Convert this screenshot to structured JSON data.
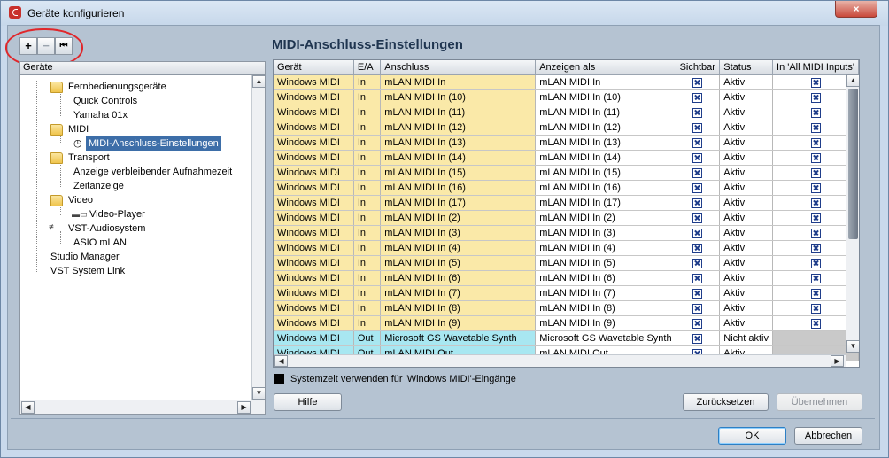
{
  "window": {
    "title": "Geräte konfigurieren",
    "close_glyph": "×"
  },
  "toolbar": {
    "add": "+",
    "remove": "−",
    "reset": "⏮"
  },
  "tree": {
    "header": "Geräte",
    "items": [
      {
        "label": "Fernbedienungsgeräte"
      },
      {
        "label": "Quick Controls"
      },
      {
        "label": "Yamaha 01x"
      },
      {
        "label": "MIDI"
      },
      {
        "label": "MIDI-Anschluss-Einstellungen"
      },
      {
        "label": "Transport"
      },
      {
        "label": "Anzeige verbleibender Aufnahmezeit"
      },
      {
        "label": "Zeitanzeige"
      },
      {
        "label": "Video"
      },
      {
        "label": "Video-Player"
      },
      {
        "label": "VST-Audiosystem"
      },
      {
        "label": "ASIO mLAN"
      },
      {
        "label": "Studio Manager"
      },
      {
        "label": "VST System Link"
      }
    ]
  },
  "panel": {
    "heading": "MIDI-Anschluss-Einstellungen"
  },
  "table": {
    "columns": [
      "Gerät",
      "E/A",
      "Anschluss",
      "Anzeigen als",
      "Sichtbar",
      "Status",
      "In 'All MIDI Inputs'"
    ],
    "rows": [
      {
        "device": "Windows MIDI",
        "io": "In",
        "port": "mLAN MIDI In",
        "show_as": "mLAN MIDI In",
        "visible": true,
        "status": "Aktiv",
        "all_inputs": true
      },
      {
        "device": "Windows MIDI",
        "io": "In",
        "port": "mLAN MIDI In (10)",
        "show_as": "mLAN MIDI In (10)",
        "visible": true,
        "status": "Aktiv",
        "all_inputs": true
      },
      {
        "device": "Windows MIDI",
        "io": "In",
        "port": "mLAN MIDI In (11)",
        "show_as": "mLAN MIDI In (11)",
        "visible": true,
        "status": "Aktiv",
        "all_inputs": true
      },
      {
        "device": "Windows MIDI",
        "io": "In",
        "port": "mLAN MIDI In (12)",
        "show_as": "mLAN MIDI In (12)",
        "visible": true,
        "status": "Aktiv",
        "all_inputs": true
      },
      {
        "device": "Windows MIDI",
        "io": "In",
        "port": "mLAN MIDI In (13)",
        "show_as": "mLAN MIDI In (13)",
        "visible": true,
        "status": "Aktiv",
        "all_inputs": true
      },
      {
        "device": "Windows MIDI",
        "io": "In",
        "port": "mLAN MIDI In (14)",
        "show_as": "mLAN MIDI In (14)",
        "visible": true,
        "status": "Aktiv",
        "all_inputs": true
      },
      {
        "device": "Windows MIDI",
        "io": "In",
        "port": "mLAN MIDI In (15)",
        "show_as": "mLAN MIDI In (15)",
        "visible": true,
        "status": "Aktiv",
        "all_inputs": true
      },
      {
        "device": "Windows MIDI",
        "io": "In",
        "port": "mLAN MIDI In (16)",
        "show_as": "mLAN MIDI In (16)",
        "visible": true,
        "status": "Aktiv",
        "all_inputs": true
      },
      {
        "device": "Windows MIDI",
        "io": "In",
        "port": "mLAN MIDI In (17)",
        "show_as": "mLAN MIDI In (17)",
        "visible": true,
        "status": "Aktiv",
        "all_inputs": true
      },
      {
        "device": "Windows MIDI",
        "io": "In",
        "port": "mLAN MIDI In (2)",
        "show_as": "mLAN MIDI In (2)",
        "visible": true,
        "status": "Aktiv",
        "all_inputs": true
      },
      {
        "device": "Windows MIDI",
        "io": "In",
        "port": "mLAN MIDI In (3)",
        "show_as": "mLAN MIDI In (3)",
        "visible": true,
        "status": "Aktiv",
        "all_inputs": true
      },
      {
        "device": "Windows MIDI",
        "io": "In",
        "port": "mLAN MIDI In (4)",
        "show_as": "mLAN MIDI In (4)",
        "visible": true,
        "status": "Aktiv",
        "all_inputs": true
      },
      {
        "device": "Windows MIDI",
        "io": "In",
        "port": "mLAN MIDI In (5)",
        "show_as": "mLAN MIDI In (5)",
        "visible": true,
        "status": "Aktiv",
        "all_inputs": true
      },
      {
        "device": "Windows MIDI",
        "io": "In",
        "port": "mLAN MIDI In (6)",
        "show_as": "mLAN MIDI In (6)",
        "visible": true,
        "status": "Aktiv",
        "all_inputs": true
      },
      {
        "device": "Windows MIDI",
        "io": "In",
        "port": "mLAN MIDI In (7)",
        "show_as": "mLAN MIDI In (7)",
        "visible": true,
        "status": "Aktiv",
        "all_inputs": true
      },
      {
        "device": "Windows MIDI",
        "io": "In",
        "port": "mLAN MIDI In (8)",
        "show_as": "mLAN MIDI In (8)",
        "visible": true,
        "status": "Aktiv",
        "all_inputs": true
      },
      {
        "device": "Windows MIDI",
        "io": "In",
        "port": "mLAN MIDI In (9)",
        "show_as": "mLAN MIDI In (9)",
        "visible": true,
        "status": "Aktiv",
        "all_inputs": true
      },
      {
        "device": "Windows MIDI",
        "io": "Out",
        "port": "Microsoft GS Wavetable Synth",
        "show_as": "Microsoft GS Wavetable Synth",
        "visible": true,
        "status": "Nicht aktiv",
        "all_inputs": null
      },
      {
        "device": "Windows MIDI",
        "io": "Out",
        "port": "mLAN MIDI Out",
        "show_as": "mLAN MIDI Out",
        "visible": true,
        "status": "Aktiv",
        "all_inputs": null
      }
    ]
  },
  "system_time_label": "Systemzeit verwenden für 'Windows MIDI'-Eingänge",
  "buttons": {
    "help": "Hilfe",
    "reset": "Zurücksetzen",
    "apply": "Übernehmen",
    "ok": "OK",
    "cancel": "Abbrechen"
  },
  "scroll_glyphs": {
    "up": "▲",
    "down": "▼",
    "left": "◀",
    "right": "▶"
  },
  "colors": {
    "input_row": "#fae9a8",
    "output_row": "#a8e7f1",
    "selection": "#3d6ea8",
    "highlight_ring": "#e0272b"
  }
}
